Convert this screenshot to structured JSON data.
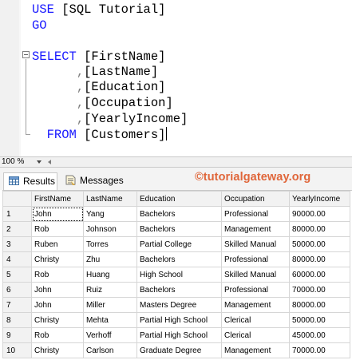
{
  "editor": {
    "lines": [
      {
        "parts": [
          {
            "t": "USE ",
            "c": "kw"
          },
          {
            "t": "[SQL Tutorial]",
            "c": "ident"
          }
        ]
      },
      {
        "parts": [
          {
            "t": "GO",
            "c": "kw"
          }
        ]
      },
      {
        "parts": []
      },
      {
        "parts": [
          {
            "t": "SELECT ",
            "c": "kw"
          },
          {
            "t": "[FirstName]",
            "c": "ident"
          }
        ]
      },
      {
        "parts": [
          {
            "t": "      ",
            "c": "ident"
          },
          {
            "t": ",",
            "c": "op"
          },
          {
            "t": "[LastName]",
            "c": "ident"
          }
        ]
      },
      {
        "parts": [
          {
            "t": "      ",
            "c": "ident"
          },
          {
            "t": ",",
            "c": "op"
          },
          {
            "t": "[Education]",
            "c": "ident"
          }
        ]
      },
      {
        "parts": [
          {
            "t": "      ",
            "c": "ident"
          },
          {
            "t": ",",
            "c": "op"
          },
          {
            "t": "[Occupation]",
            "c": "ident"
          }
        ]
      },
      {
        "parts": [
          {
            "t": "      ",
            "c": "ident"
          },
          {
            "t": ",",
            "c": "op"
          },
          {
            "t": "[YearlyIncome]",
            "c": "ident"
          }
        ]
      },
      {
        "parts": [
          {
            "t": "  FROM ",
            "c": "kw"
          },
          {
            "t": "[Customers]",
            "c": "ident"
          }
        ]
      }
    ]
  },
  "zoom": "100 %",
  "tabs": {
    "results": "Results",
    "messages": "Messages"
  },
  "brand": "©tutorialgateway.org",
  "grid": {
    "columns": [
      "FirstName",
      "LastName",
      "Education",
      "Occupation",
      "YearlyIncome"
    ],
    "rows": [
      [
        "1",
        "John",
        "Yang",
        "Bachelors",
        "Professional",
        "90000.00"
      ],
      [
        "2",
        "Rob",
        "Johnson",
        "Bachelors",
        "Management",
        "80000.00"
      ],
      [
        "3",
        "Ruben",
        "Torres",
        "Partial College",
        "Skilled Manual",
        "50000.00"
      ],
      [
        "4",
        "Christy",
        "Zhu",
        "Bachelors",
        "Professional",
        "80000.00"
      ],
      [
        "5",
        "Rob",
        "Huang",
        "High School",
        "Skilled Manual",
        "60000.00"
      ],
      [
        "6",
        "John",
        "Ruiz",
        "Bachelors",
        "Professional",
        "70000.00"
      ],
      [
        "7",
        "John",
        "Miller",
        "Masters Degree",
        "Management",
        "80000.00"
      ],
      [
        "8",
        "Christy",
        "Mehta",
        "Partial High School",
        "Clerical",
        "50000.00"
      ],
      [
        "9",
        "Rob",
        "Verhoff",
        "Partial High School",
        "Clerical",
        "45000.00"
      ],
      [
        "10",
        "Christy",
        "Carlson",
        "Graduate Degree",
        "Management",
        "70000.00"
      ]
    ]
  }
}
